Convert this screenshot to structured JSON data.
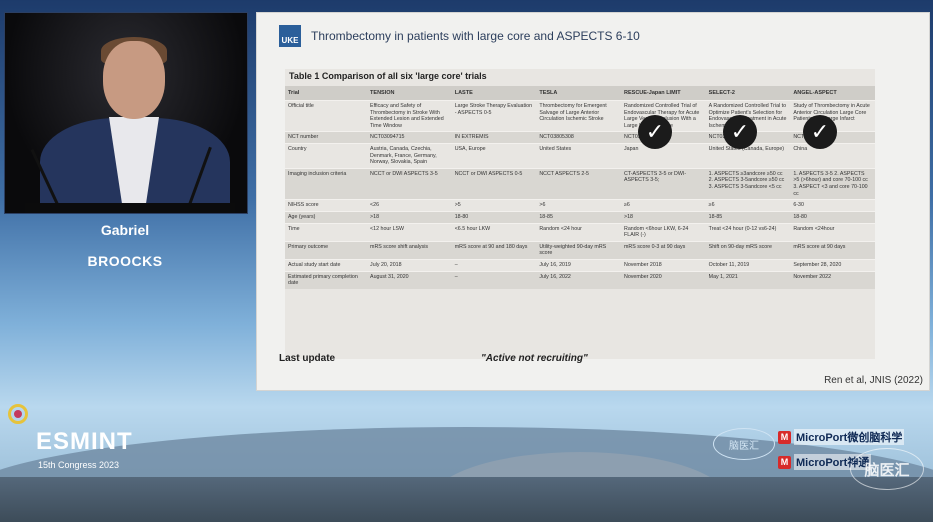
{
  "speaker": {
    "first_name": "Gabriel",
    "last_name": "BROOCKS"
  },
  "slide": {
    "logo_text": "UKE",
    "title": "Thrombectomy in patients with large core and ASPECTS 6-10",
    "table_caption": "Table 1    Comparison of all six 'large core' trials",
    "columns": [
      "Trial",
      "TENSION",
      "LASTE",
      "TESLA",
      "RESCUE-Japan LIMIT",
      "SELECT-2",
      "ANGEL-ASPECT"
    ],
    "rows": [
      {
        "label": "Official title",
        "cells": [
          "Efficacy and Safety of Thrombectomy in Stroke With Extended Lesion and Extended Time Window",
          "Large Stroke Therapy Evaluation - ASPECTS 0-5",
          "Thrombectomy for Emergent Salvage of Large Anterior Circulation Ischemic Stroke",
          "Randomized Controlled Trial of Endovascular Therapy for Acute Large Vessel Occlusion With a Large Ischemic Core",
          "A Randomized Controlled Trial to Optimize Patient's Selection for Endovascular Treatment in Acute Ischemic Stroke",
          "Study of Thrombectomy in Acute Anterior Circulation Large Core Patients with Large Infarct"
        ]
      },
      {
        "label": "NCT number",
        "cells": [
          "NCT03094715",
          "IN EXTREMIS",
          "NCT03805308",
          "NCT03702413",
          "NCT03876457",
          "NCT04551664"
        ]
      },
      {
        "label": "Country",
        "cells": [
          "Austria, Canada, Czechia, Denmark, France, Germany, Norway, Slovakia, Spain",
          "USA, Europe",
          "United States",
          "Japan",
          "United States (Canada, Europe)",
          "China"
        ]
      },
      {
        "label": "Imaging inclusion criteria",
        "cells": [
          "NCCT or DWI ASPECTS 3-5",
          "NCCT or DWI ASPECTS 0-5",
          "NCCT ASPECTS 2-5",
          "CT-ASPECTS 3-5 or DWI-ASPECTS 3-5;",
          "1. ASPECTS ≥3andcore ≥50 cc 2. ASPECTS 3-5andcore ≥50 cc 3. ASPECTS 3-5andcore <5 cc",
          "1. ASPECTS 3-5 2. ASPECTS >5 (>6hour) and core 70-100 cc 3. ASPECT <3 and core 70-100 cc"
        ]
      },
      {
        "label": "NIHSS score",
        "cells": [
          "<26",
          ">5",
          ">6",
          "≥6",
          "≥6",
          "6-30"
        ]
      },
      {
        "label": "Age (years)",
        "cells": [
          ">18",
          "18-80",
          "18-85",
          ">18",
          "18-85",
          "18-80"
        ]
      },
      {
        "label": "Time",
        "cells": [
          "<12 hour LSW",
          "<6.5 hour LKW",
          "Random <24 hour",
          "Random <6hour LKW, 6-24 FLAIR (-)",
          "Treat <24 hour (0-12 vs6-24)",
          "Random <24hour"
        ]
      },
      {
        "label": "Primary outcome",
        "cells": [
          "mRS score shift analysis",
          "mRS score at 90 and 180 days",
          "Utility-weighted 90-day mRS score",
          "mRS score 0-3 at 90 days",
          "Shift on 90-day mRS score",
          "mRS score at 90 days"
        ]
      },
      {
        "label": "Actual study start date",
        "cells": [
          "July 20, 2018",
          "–",
          "July 16, 2019",
          "November 2018",
          "October 11, 2019",
          "September 28, 2020"
        ]
      },
      {
        "label": "Estimated primary completion date",
        "cells": [
          "August 31, 2020",
          "–",
          "July 16, 2022",
          "November 2020",
          "May 1, 2021",
          "November 2022"
        ]
      }
    ],
    "last_update": "Last update",
    "status_note": "\"Active not recruiting\"",
    "citation": "Ren et al, JNIS (2022)"
  },
  "branding": {
    "conference": "ESMINT",
    "congress": "15th Congress 2023",
    "partner_badge": "脑医汇",
    "sponsor_1": "MicroPort微创脑科学",
    "sponsor_2": "MicroPort神通",
    "watermark": "脑医汇"
  }
}
